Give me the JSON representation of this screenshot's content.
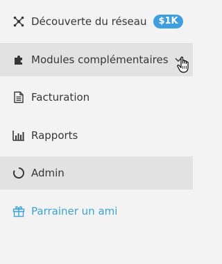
{
  "menu": {
    "items": [
      {
        "label": "Découverte du réseau",
        "icon": "network-icon",
        "badge": "$1K"
      },
      {
        "label": "Modules complémentaires",
        "icon": "puzzle-icon",
        "has_chevron": true
      },
      {
        "label": "Facturation",
        "icon": "document-icon"
      },
      {
        "label": "Rapports",
        "icon": "bar-chart-icon"
      },
      {
        "label": "Admin",
        "icon": "refresh-icon"
      },
      {
        "label": "Parrainer un ami",
        "icon": "gift-icon"
      }
    ]
  },
  "colors": {
    "text": "#363636",
    "highlight": "#e2e2e2",
    "badge": "#3d9ee0",
    "link": "#3aa3d8",
    "background": "#f3f3f3"
  },
  "cursor": "pointer-hand-icon"
}
